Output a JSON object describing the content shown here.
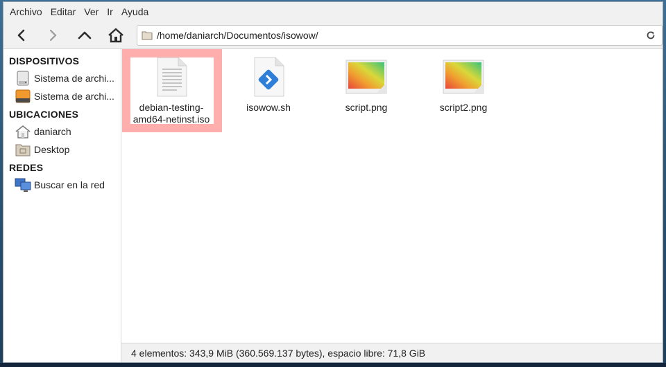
{
  "menu": [
    "Archivo",
    "Editar",
    "Ver",
    "Ir",
    "Ayuda"
  ],
  "location": {
    "path": "/home/daniarch/Documentos/isowow/"
  },
  "sidebar": {
    "sections": [
      {
        "title": "DISPOSITIVOS",
        "items": [
          {
            "label": "Sistema de archi...",
            "icon": "disk-drive-icon"
          },
          {
            "label": "Sistema de archi...",
            "icon": "orange-drive-icon"
          }
        ]
      },
      {
        "title": "UBICACIONES",
        "items": [
          {
            "label": "daniarch",
            "icon": "home-folder-icon"
          },
          {
            "label": "Desktop",
            "icon": "desktop-folder-icon"
          }
        ]
      },
      {
        "title": "REDES",
        "items": [
          {
            "label": "Buscar en la red",
            "icon": "network-icon"
          }
        ]
      }
    ]
  },
  "files": [
    {
      "name_line1": "debian-testing-",
      "name_line2": "amd64-netinst.iso",
      "icon": "text-document-icon",
      "selected": true
    },
    {
      "name_line1": "isowow.sh",
      "name_line2": "",
      "icon": "script-file-icon",
      "selected": false
    },
    {
      "name_line1": "script.png",
      "name_line2": "",
      "icon": "image-thumbnail-icon",
      "selected": false
    },
    {
      "name_line1": "script2.png",
      "name_line2": "",
      "icon": "image-thumbnail-icon",
      "selected": false
    }
  ],
  "status": {
    "text": "4 elementos: 343,9 MiB (360.569.137 bytes), espacio libre: 71,8 GiB"
  },
  "colors": {
    "selection": "#ff7878",
    "window_bg": "#ffffff",
    "chrome_bg": "#f1f1f1"
  }
}
